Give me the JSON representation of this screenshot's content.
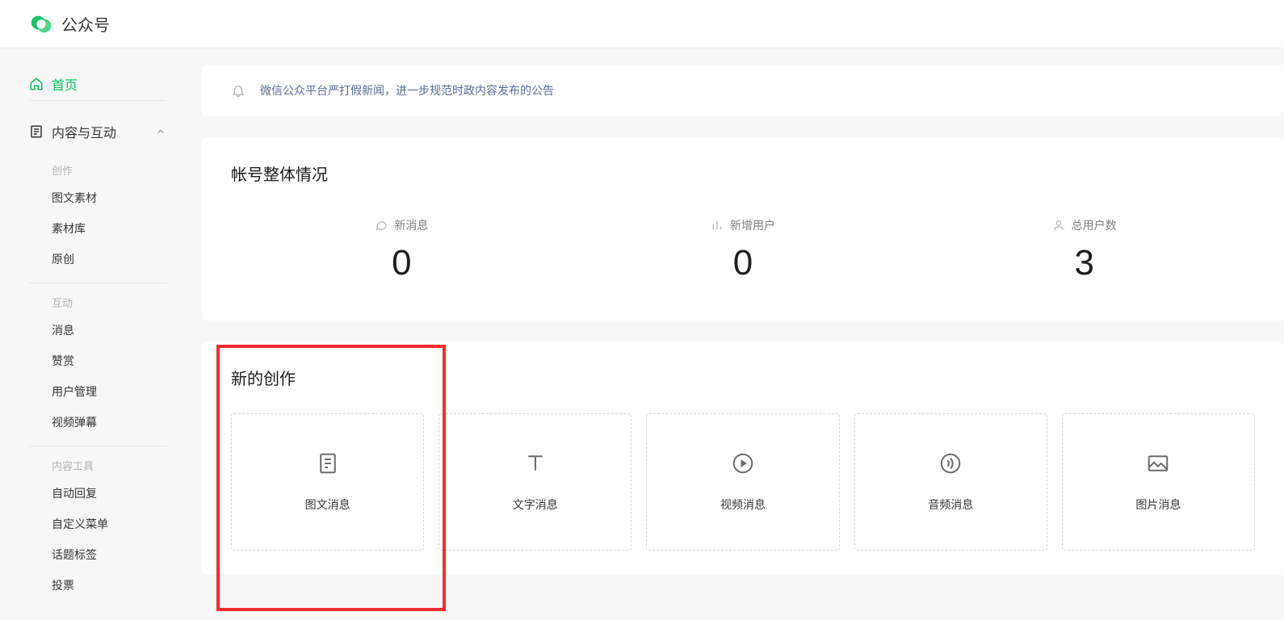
{
  "header": {
    "title": "公众号"
  },
  "sidebar": {
    "home_label": "首页",
    "group_label": "内容与互动",
    "sections": {
      "creation": {
        "label": "创作",
        "items": [
          "图文素材",
          "素材库",
          "原创"
        ]
      },
      "interaction": {
        "label": "互动",
        "items": [
          "消息",
          "赞赏",
          "用户管理",
          "视频弹幕"
        ]
      },
      "tools": {
        "label": "内容工具",
        "items": [
          "自动回复",
          "自定义菜单",
          "话题标签",
          "投票"
        ]
      }
    }
  },
  "notice": {
    "text": "微信公众平台严打假新闻，进一步规范时政内容发布的公告"
  },
  "overview": {
    "title": "帐号整体情况",
    "stats": [
      {
        "label": "新消息",
        "value": "0"
      },
      {
        "label": "新增用户",
        "value": "0"
      },
      {
        "label": "总用户数",
        "value": "3"
      }
    ]
  },
  "create": {
    "title": "新的创作",
    "items": [
      {
        "label": "图文消息",
        "icon": "doc"
      },
      {
        "label": "文字消息",
        "icon": "text"
      },
      {
        "label": "视频消息",
        "icon": "video"
      },
      {
        "label": "音频消息",
        "icon": "audio"
      },
      {
        "label": "图片消息",
        "icon": "image"
      }
    ]
  }
}
